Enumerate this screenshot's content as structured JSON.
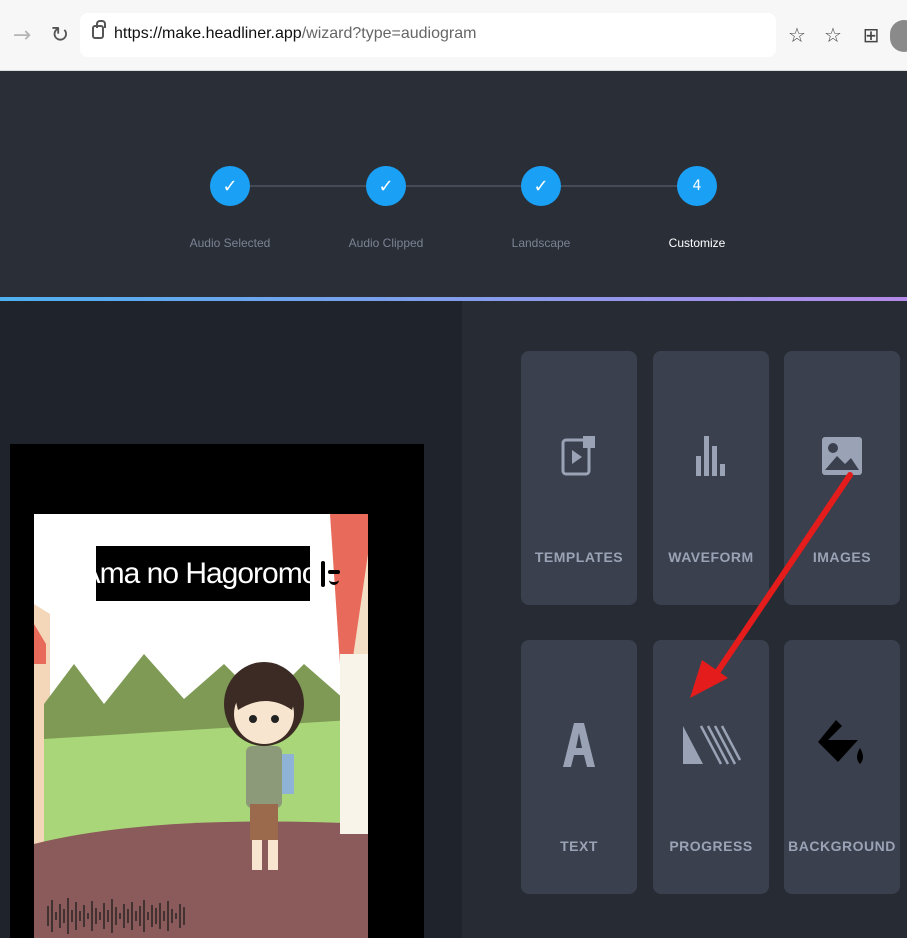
{
  "browser": {
    "url_host": "https://make.headliner.app",
    "url_path": "/wizard?type=audiogram"
  },
  "wizard": {
    "steps": [
      {
        "number": "✓",
        "label": "Audio Selected"
      },
      {
        "number": "✓",
        "label": "Audio Clipped"
      },
      {
        "number": "✓",
        "label": "Landscape"
      },
      {
        "number": "4",
        "label": "Customize"
      }
    ]
  },
  "preview": {
    "title_text": "Ama no Hagoromo"
  },
  "tools": [
    {
      "label": "TEMPLATES",
      "icon": "templates-icon"
    },
    {
      "label": "WAVEFORM",
      "icon": "waveform-icon"
    },
    {
      "label": "IMAGES",
      "icon": "images-icon"
    },
    {
      "label": "TEXT",
      "icon": "text-icon"
    },
    {
      "label": "PROGRESS",
      "icon": "progress-icon"
    },
    {
      "label": "BACKGROUND",
      "icon": "background-icon"
    }
  ],
  "colors": {
    "step_active": "#1aa1f5",
    "annotation_arrow": "#e51c1c"
  }
}
